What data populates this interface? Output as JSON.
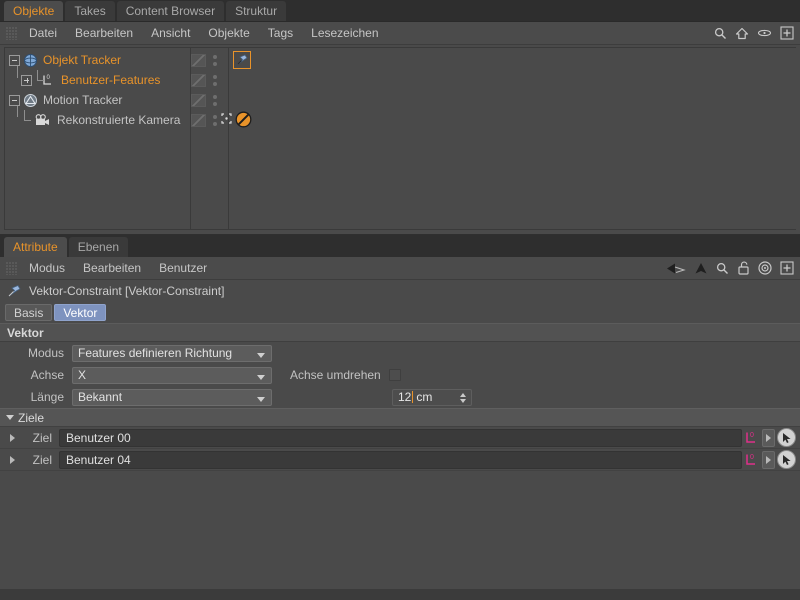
{
  "object_manager": {
    "tabs": [
      {
        "label": "Objekte",
        "active": true
      },
      {
        "label": "Takes",
        "active": false
      },
      {
        "label": "Content Browser",
        "active": false
      },
      {
        "label": "Struktur",
        "active": false
      }
    ],
    "menu": [
      "Datei",
      "Bearbeiten",
      "Ansicht",
      "Objekte",
      "Tags",
      "Lesezeichen"
    ],
    "toolbar_icons": [
      "search-icon",
      "home-icon",
      "eye-icon",
      "plus-icon"
    ],
    "tree": [
      {
        "label": "Objekt Tracker",
        "color": "#e8932a",
        "icon": "object-tracker-icon",
        "depth": 0,
        "expander": "minus",
        "has_tag": true,
        "tag_icon": "vector-constraint-tag-icon",
        "tag_selected": true
      },
      {
        "label": "Benutzer-Features",
        "color": "#e8932a",
        "icon": "user-features-icon",
        "depth": 1,
        "expander": "plus",
        "has_tag": false
      },
      {
        "label": "Motion Tracker",
        "color": "#c4c4c4",
        "icon": "motion-tracker-icon",
        "depth": 0,
        "expander": "minus",
        "has_tag": false
      },
      {
        "label": "Rekonstruierte Kamera",
        "color": "#c4c4c4",
        "icon": "camera-icon",
        "depth": 1,
        "expander": "none",
        "has_tag": true,
        "tag_icon": "disabled-tag-icon",
        "tag_selected": false
      }
    ]
  },
  "attribute_manager": {
    "tabs": [
      {
        "label": "Attribute",
        "active": true
      },
      {
        "label": "Ebenen",
        "active": false
      }
    ],
    "menu": [
      "Modus",
      "Bearbeiten",
      "Benutzer"
    ],
    "toolbar_icons": [
      "back-arrow-icon",
      "up-arrow-icon",
      "search-icon",
      "lock-open-icon",
      "target-icon",
      "plus-icon"
    ],
    "object_title": "Vektor-Constraint [Vektor-Constraint]",
    "object_icon": "vector-constraint-tag-icon",
    "subtabs": [
      {
        "label": "Basis",
        "active": false
      },
      {
        "label": "Vektor",
        "active": true
      }
    ],
    "section_title": "Vektor",
    "fields": {
      "modus": {
        "label": "Modus",
        "value": "Features definieren Richtung"
      },
      "achse": {
        "label": "Achse",
        "value": "X"
      },
      "laenge": {
        "label": "Länge",
        "value": "Bekannt"
      },
      "achse_umdrehen": {
        "label": "Achse umdrehen",
        "checked": false
      },
      "laenge_value": {
        "number": "12",
        "unit": "cm",
        "focused": true
      }
    },
    "targets_group": {
      "label": "Ziele",
      "expanded": true,
      "rows": [
        {
          "label": "Ziel",
          "value": "Benutzer 00",
          "link_icon": "user-data-icon",
          "pick_icon": "cursor-pick-icon"
        },
        {
          "label": "Ziel",
          "value": "Benutzer 04",
          "link_icon": "user-data-icon",
          "pick_icon": "cursor-pick-icon"
        }
      ]
    }
  },
  "colors": {
    "accent_orange": "#e8932a",
    "panel_bg": "#4a4a4a",
    "window_bg": "#3b3b3b",
    "tabstrip_bg": "#2e2e2e",
    "active_subtab_blue": "#7e93bf",
    "link_icon_magenta": "#e02f8a"
  }
}
